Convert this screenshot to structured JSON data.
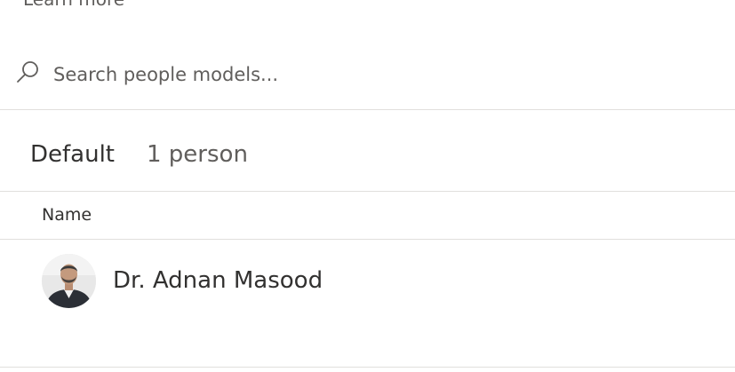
{
  "top_cut_text": "Learn more",
  "search": {
    "icon": "search-icon",
    "placeholder": "Search people models...",
    "value": ""
  },
  "group": {
    "name": "Default",
    "count": "1 person"
  },
  "table": {
    "columns": [
      "Name"
    ],
    "rows": [
      {
        "avatar": "person-photo",
        "name": "Dr. Adnan Masood"
      }
    ]
  },
  "colors": {
    "divider": "#e1dfdd",
    "text_primary": "#323130",
    "text_secondary": "#605e5c",
    "background": "#ffffff"
  }
}
